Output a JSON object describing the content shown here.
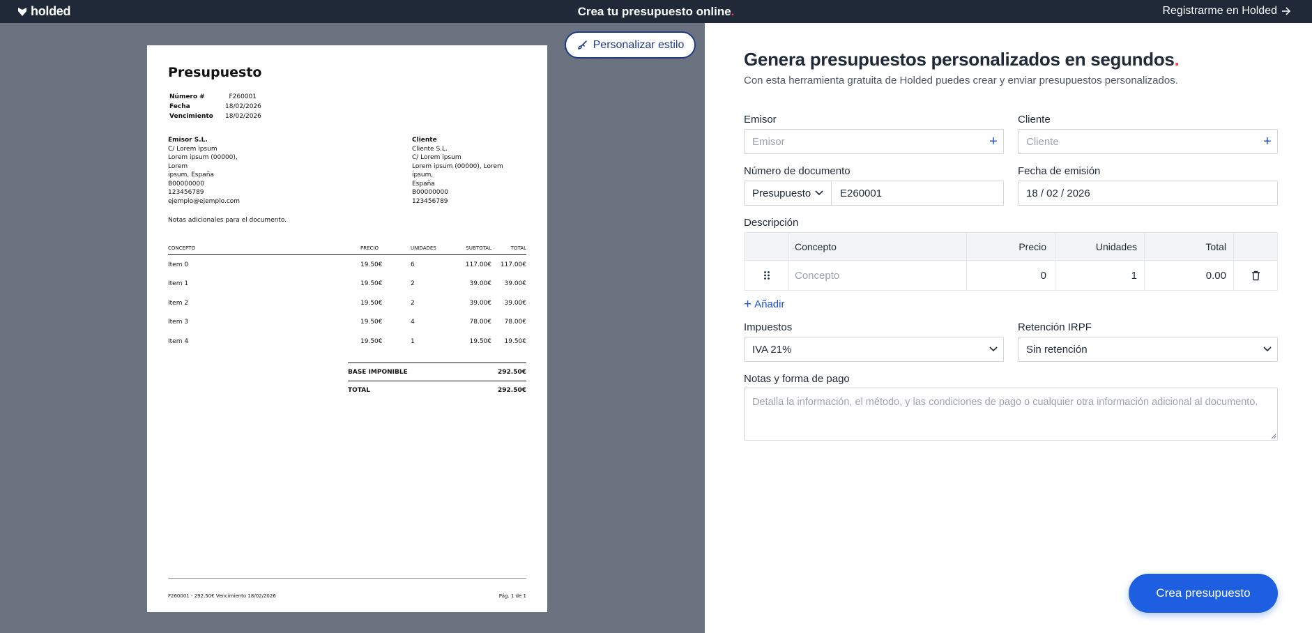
{
  "topbar": {
    "logo_text": "holded",
    "title": "Crea tu presupuesto online",
    "title_dot": ".",
    "register_label": "Registrarme en Holded"
  },
  "preview": {
    "style_button_label": "Personalizar estilo",
    "doc_title": "Presupuesto",
    "meta": [
      {
        "key": "Número #",
        "value": "F260001"
      },
      {
        "key": "Fecha",
        "value": "18/02/2026"
      },
      {
        "key": "Vencimiento",
        "value": "18/02/2026"
      }
    ],
    "emisor": {
      "name": "Emisor S.L.",
      "lines": [
        "C/ Lorem ipsum",
        "Lorem ipsum (00000), Lorem",
        "ipsum, España",
        "B00000000",
        "123456789",
        "ejemplo@ejemplo.com"
      ]
    },
    "cliente": {
      "name": "Cliente",
      "lines": [
        "Cliente S.L.",
        "C/ Lorem ipsum",
        "Lorem ipsum (00000), Lorem ipsum,",
        "España",
        "B00000000",
        "123456789"
      ]
    },
    "notes": "Notas adicionales para el documento.",
    "columns": [
      "CONCEPTO",
      "PRECIO",
      "UNIDADES",
      "SUBTOTAL",
      "TOTAL"
    ],
    "items": [
      {
        "concept": "Item 0",
        "price": "19.50€",
        "units": "6",
        "subtotal": "117.00€",
        "total": "117.00€"
      },
      {
        "concept": "Item 1",
        "price": "19.50€",
        "units": "2",
        "subtotal": "39.00€",
        "total": "39.00€"
      },
      {
        "concept": "Item 2",
        "price": "19.50€",
        "units": "2",
        "subtotal": "39.00€",
        "total": "39.00€"
      },
      {
        "concept": "Item 3",
        "price": "19.50€",
        "units": "4",
        "subtotal": "78.00€",
        "total": "78.00€"
      },
      {
        "concept": "Item 4",
        "price": "19.50€",
        "units": "1",
        "subtotal": "19.50€",
        "total": "19.50€"
      }
    ],
    "base_label": "BASE IMPONIBLE",
    "base_value": "292.50€",
    "total_label": "TOTAL",
    "total_value": "292.50€",
    "footer_left": "F260001 - 292.50€ Vencimiento 18/02/2026",
    "footer_right": "Pág. 1 de 1"
  },
  "form": {
    "heading": "Genera presupuestos personalizados en segundos",
    "heading_dot": ".",
    "subheading": "Con esta herramienta gratuita de Holded puedes crear y enviar presupuestos personalizados.",
    "emisor_label": "Emisor",
    "emisor_placeholder": "Emisor",
    "cliente_label": "Cliente",
    "cliente_placeholder": "Cliente",
    "plus": "+",
    "docnum_label": "Número de documento",
    "doc_type": "Presupuesto",
    "doc_number": "E260001",
    "date_label": "Fecha de emisión",
    "date_value": "18 / 02 / 2026",
    "desc_label": "Descripción",
    "desc_columns": {
      "concept": "Concepto",
      "price": "Precio",
      "units": "Unidades",
      "total": "Total"
    },
    "desc_row": {
      "concept_placeholder": "Concepto",
      "price": "0",
      "units": "1",
      "total": "0.00"
    },
    "add_label": "Añadir",
    "tax_label": "Impuestos",
    "tax_value": "IVA 21%",
    "irpf_label": "Retención IRPF",
    "irpf_value": "Sin retención",
    "notes_label": "Notas y forma de pago",
    "notes_placeholder": "Detalla la información, el método, y las condiciones de pago o cualquier otra información adicional al documento.",
    "cta_label": "Crea presupuesto"
  },
  "colors": {
    "topbar": "#1f2937",
    "preview_bg": "#6b7280",
    "accent": "#1d5fe0",
    "dot": "#ef4444"
  }
}
